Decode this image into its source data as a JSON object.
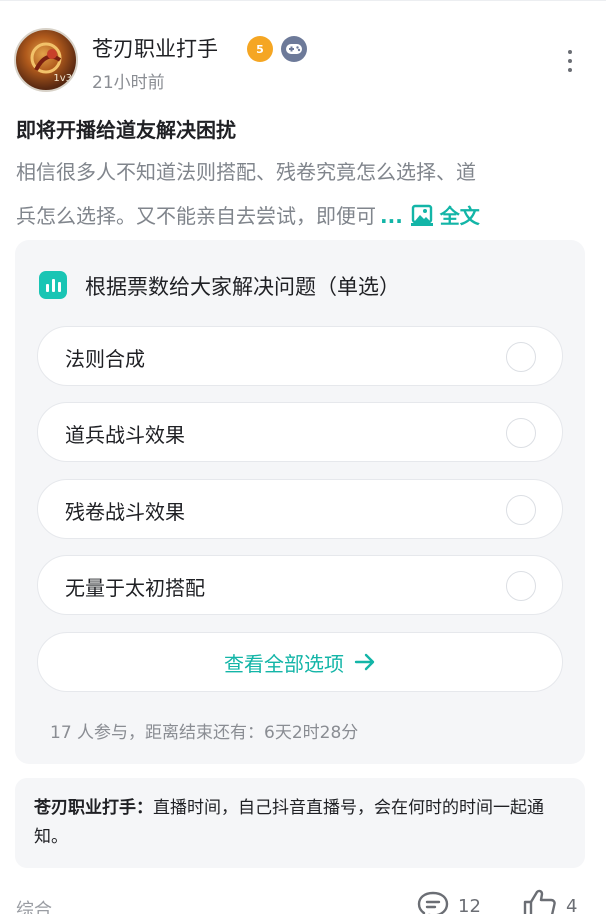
{
  "post": {
    "author": "苍刃职业打手",
    "level_badge": "5",
    "time": "21小时前",
    "title": "即将开播给道友解决困扰",
    "excerpt_line1": "相信很多人不知道法则搭配、残卷究竟怎么选择、道",
    "excerpt_line2": "兵怎么选择。又不能亲自去尝试，即便可",
    "ellipsis": "...",
    "full_text_label": "全文",
    "avatar_tag": "1v3"
  },
  "poll": {
    "title": "根据票数给大家解决问题（单选）",
    "options": [
      {
        "label": "法则合成"
      },
      {
        "label": "道兵战斗效果"
      },
      {
        "label": "残卷战斗效果"
      },
      {
        "label": "无量于太初搭配"
      }
    ],
    "view_all_label": "查看全部选项",
    "status": "17 人参与，距离结束还有：6天2时28分"
  },
  "reply": {
    "author": "苍刃职业打手：",
    "text": "直播时间，自己抖音直播号，会在何时的时间一起通知。"
  },
  "footer": {
    "tag": "综合",
    "comments": "12",
    "likes": "4"
  },
  "colors": {
    "accent": "#13b5a7",
    "card_bg": "#f5f6f8",
    "muted_text": "#80858c"
  },
  "icons": [
    "more-vertical-icon",
    "level-badge-icon",
    "gamepad-badge-icon",
    "image-icon",
    "poll-chart-icon",
    "radio-icon",
    "arrow-right-icon",
    "comment-icon",
    "thumbs-up-icon"
  ]
}
